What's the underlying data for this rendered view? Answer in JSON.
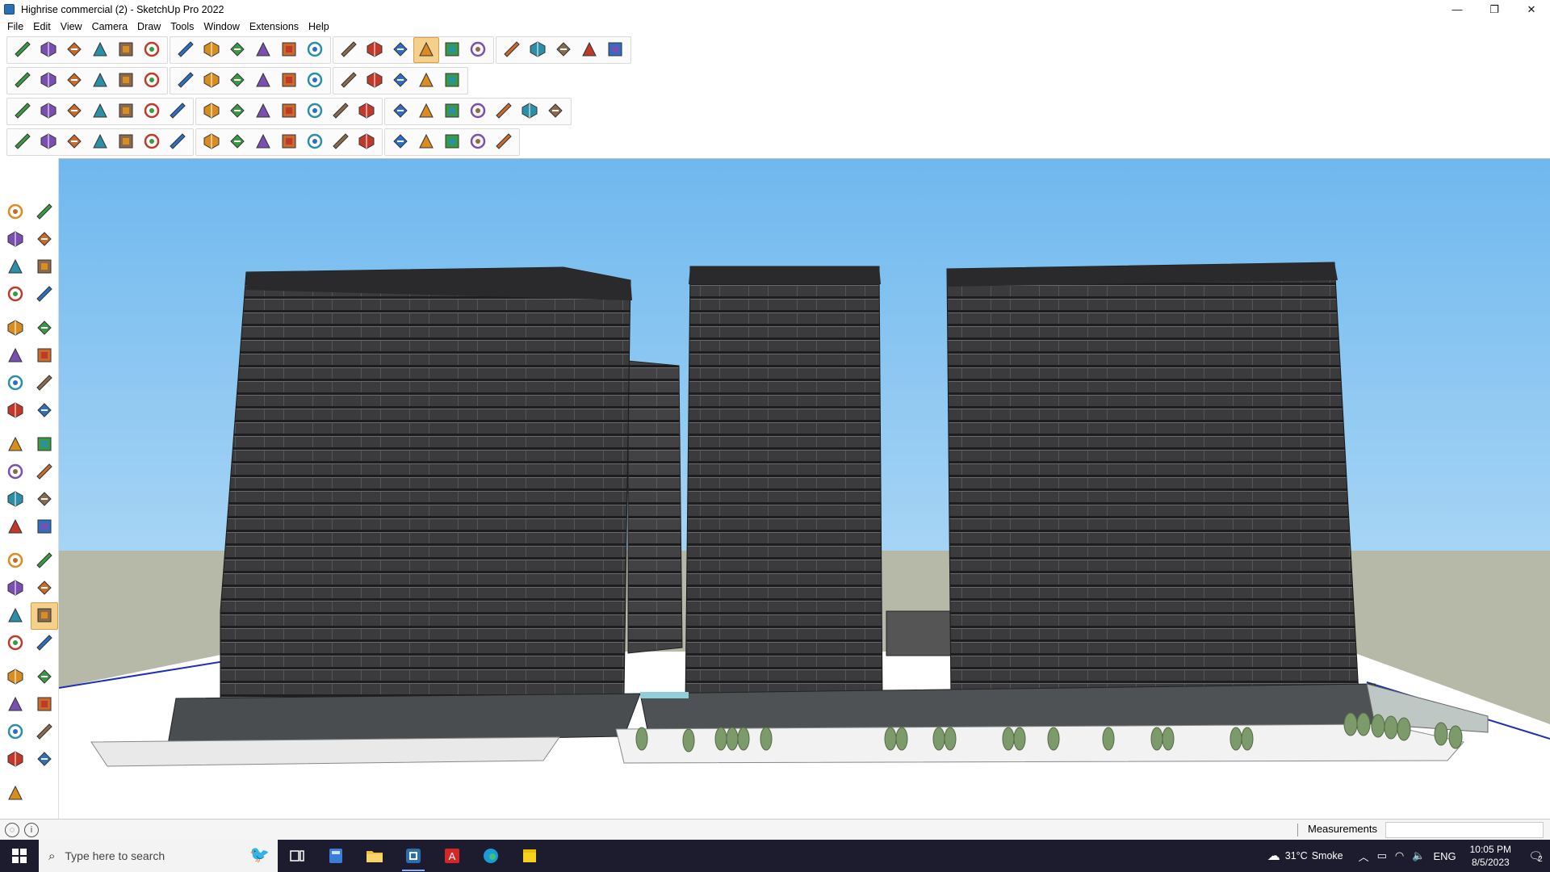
{
  "window": {
    "title": "Highrise commercial (2) - SketchUp Pro 2022",
    "minimize_glyph": "—",
    "maximize_glyph": "❐",
    "close_glyph": "✕"
  },
  "menu": {
    "items": [
      "File",
      "Edit",
      "View",
      "Camera",
      "Draw",
      "Tools",
      "Window",
      "Extensions",
      "Help"
    ]
  },
  "toolbars": {
    "active_tool": "pan-icon",
    "row1_icons": [
      "zoom-icon",
      "select-icon",
      "eraser-icon",
      "line-icon",
      "arc-icon",
      "rectangle-icon",
      "push-pull-icon",
      "follow-me-icon",
      "move-icon",
      "rotate-icon",
      "scale-icon",
      "tape-measure-icon",
      "text-icon",
      "paint-bucket-icon",
      "orbit-icon",
      "pan-icon",
      "zoom-window-icon",
      "zoom-extents-icon",
      "section-plane-icon",
      "styles-icon",
      "layers-icon",
      "outliner-icon",
      "account-icon"
    ],
    "row2_icons": [
      "iso-view-icon",
      "top-view-icon",
      "front-view-icon",
      "extrude-icon",
      "push-icon",
      "pull-icon",
      "sandbox-icon",
      "wall-icon",
      "roof-icon",
      "house-icon",
      "solid-tools-icon",
      "curve-icon",
      "intersect-icon",
      "hatch-icon",
      "paint-icon",
      "section-fill-icon",
      "shape-icon"
    ],
    "row3_icons": [
      "component-icon",
      "group-icon",
      "face-icon",
      "plane-icon",
      "stairs-icon",
      "window-icon",
      "door-icon",
      "frame-icon",
      "box-icon",
      "grid-icon",
      "array-icon",
      "spline-icon",
      "cross-icon",
      "mirror-icon",
      "cone-icon",
      "triangle-icon",
      "loop-icon",
      "star-icon",
      "cut-icon",
      "bridge-icon",
      "layers-icon"
    ],
    "row4_icons": [
      "polyline-icon",
      "bezier-icon",
      "subdivide-icon",
      "slice-icon",
      "gear-icon",
      "path-icon",
      "railing-icon",
      "texture-icon",
      "truss-icon",
      "fillet-icon",
      "chamfer-icon",
      "offset-icon",
      "extend-icon",
      "railing2-icon",
      "fence-icon",
      "tree-icon",
      "hand-icon",
      "shade-icon",
      "panel-icon"
    ]
  },
  "left_toolbar": {
    "icons": [
      "select-arrow-icon",
      "orbit-icon",
      "paint-bucket-icon",
      "eraser-icon",
      "make-component-icon",
      "pencil-icon",
      "line-icon",
      "freehand-icon",
      "rectangle-icon",
      "rotated-rectangle-icon",
      "circle-icon",
      "polygon-icon",
      "arc-icon",
      "pie-icon",
      "two-point-arc-icon",
      "three-point-arc-icon",
      "move-icon",
      "push-pull-icon",
      "rotate-icon",
      "follow-me-icon",
      "scale-icon",
      "offset-icon",
      "tape-measure-icon",
      "dimension-icon",
      "protractor-icon",
      "text-icon",
      "axes-icon",
      "3d-text-icon",
      "orbit-nav-icon",
      "pan-icon",
      "zoom-icon",
      "zoom-window-icon",
      "zoom-extents-icon",
      "previous-view-icon",
      "position-camera-icon",
      "look-around-icon",
      "walk-icon",
      "section-plane-icon",
      "display-section-icon",
      "layers-icon",
      "outliner-icon"
    ]
  },
  "statusbar": {
    "measurements_label": "Measurements",
    "measurements_value": ""
  },
  "taskbar": {
    "search_placeholder": "Type here to search",
    "weather_temp": "31°C",
    "weather_desc": "Smoke",
    "language": "ENG",
    "time": "10:05 PM",
    "date": "8/5/2023",
    "notification_count": "2"
  },
  "colors": {
    "sky_top": "#6fb8ee",
    "sky_bottom": "#9dd0f4",
    "ground": "#b7b9a8",
    "building": "#3d3d3f",
    "accent_active": "#f4d08a"
  }
}
